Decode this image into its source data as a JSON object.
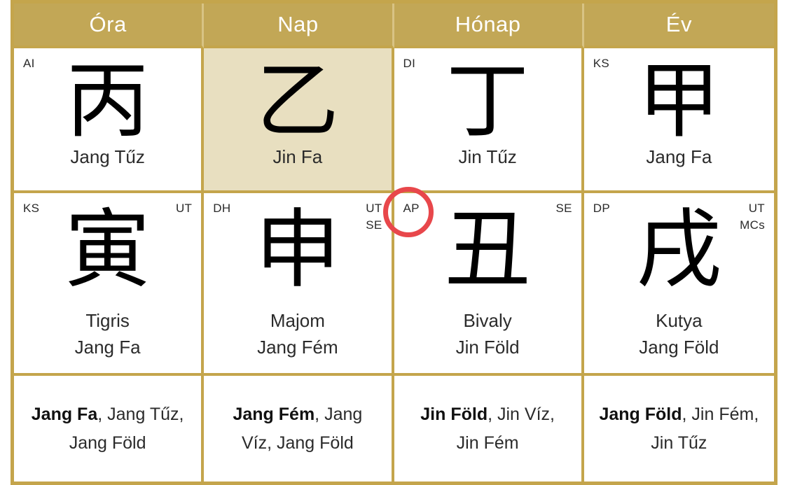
{
  "header": {
    "columns": [
      "Óra",
      "Nap",
      "Hónap",
      "Év"
    ]
  },
  "colors": {
    "header_bg": "#c2a756",
    "header_text": "#ffffff",
    "border": "#c4a54c",
    "highlight_bg": "#e8dfc0",
    "annotation": "#e8474b",
    "text": "#2b2b2b"
  },
  "rows": {
    "stems": [
      {
        "column": "Óra",
        "corner_left": "AI",
        "corner_right": "",
        "glyph": "丙",
        "label": "Jang Tűz",
        "highlighted": false
      },
      {
        "column": "Nap",
        "corner_left": "",
        "corner_right": "",
        "glyph": "乙",
        "label": "Jin Fa",
        "highlighted": true
      },
      {
        "column": "Hónap",
        "corner_left": "DI",
        "corner_right": "",
        "glyph": "丁",
        "label": "Jin Tűz",
        "highlighted": false
      },
      {
        "column": "Év",
        "corner_left": "KS",
        "corner_right": "",
        "glyph": "甲",
        "label": "Jang Fa",
        "highlighted": false
      }
    ],
    "branches": [
      {
        "column": "Óra",
        "corner_left": "KS",
        "corner_right_1": "UT",
        "corner_right_2": "",
        "glyph": "寅",
        "animal": "Tigris",
        "element": "Jang Fa"
      },
      {
        "column": "Nap",
        "corner_left": "DH",
        "corner_right_1": "UT",
        "corner_right_2": "SE",
        "glyph": "申",
        "animal": "Majom",
        "element": "Jang Fém"
      },
      {
        "column": "Hónap",
        "corner_left": "AP",
        "corner_right_1": "SE",
        "corner_right_2": "",
        "glyph": "丑",
        "animal": "Bivaly",
        "element": "Jin Föld"
      },
      {
        "column": "Év",
        "corner_left": "DP",
        "corner_right_1": "UT",
        "corner_right_2": "MCs",
        "glyph": "戌",
        "animal": "Kutya",
        "element": "Jang Föld"
      }
    ],
    "hidden": [
      {
        "column": "Óra",
        "primary": "Jang Fa",
        "rest": ", Jang Tűz, Jang Föld"
      },
      {
        "column": "Nap",
        "primary": "Jang Fém",
        "rest": ", Jang Víz, Jang Föld"
      },
      {
        "column": "Hónap",
        "primary": "Jin Föld",
        "rest": ", Jin Víz, Jin Fém"
      },
      {
        "column": "Év",
        "primary": "Jang Föld",
        "rest": ", Jin Fém, Jin Tűz"
      }
    ]
  },
  "annotation": {
    "name": "red-circle-highlight",
    "target": "AP"
  }
}
